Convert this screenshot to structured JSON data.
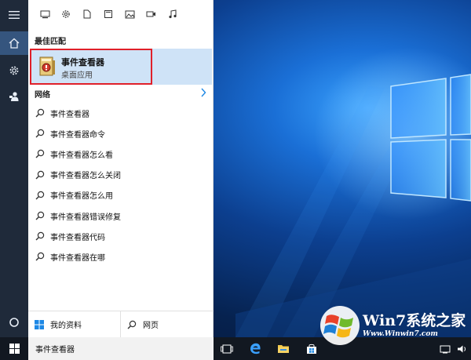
{
  "colors": {
    "rail_bg": "#1f2a3a",
    "rail_active": "#35557e",
    "panel_bg": "#ffffff",
    "highlight": "#cfe3f7",
    "highlight_border": "#e0202a",
    "taskbar_bg": "#121821",
    "accent": "#1e88e5"
  },
  "rail": {
    "items": [
      {
        "icon": "hamburger-menu-icon"
      },
      {
        "icon": "home-icon",
        "active": true
      },
      {
        "icon": "settings-gear-icon"
      },
      {
        "icon": "feedback-person-icon"
      },
      {
        "icon": "cortana-circle-icon"
      }
    ]
  },
  "filters": {
    "icons": [
      "apps-filter-icon",
      "settings-filter-icon",
      "documents-filter-icon",
      "folders-filter-icon",
      "photos-filter-icon",
      "videos-filter-icon",
      "music-filter-icon"
    ]
  },
  "best_match": {
    "header": "最佳匹配",
    "title": "事件查看器",
    "subtitle": "桌面应用",
    "icon": "event-viewer-icon"
  },
  "web": {
    "header": "网络",
    "suggestions": [
      "事件查看器",
      "事件查看器命令",
      "事件查看器怎么看",
      "事件查看器怎么关闭",
      "事件查看器怎么用",
      "事件查看器错误修复",
      "事件查看器代码",
      "事件查看器在哪"
    ]
  },
  "bottom": {
    "my_stuff": "我的资料",
    "web": "网页"
  },
  "taskbar": {
    "search_text": "事件查看器",
    "icons": [
      "start-windows-icon",
      "task-view-icon",
      "edge-browser-icon",
      "file-explorer-icon",
      "store-icon"
    ],
    "tray_icons": [
      "wifi-icon",
      "volume-icon"
    ]
  },
  "watermark": {
    "brand": "Win7系统之家",
    "url": "Www.Winwin7.com"
  }
}
